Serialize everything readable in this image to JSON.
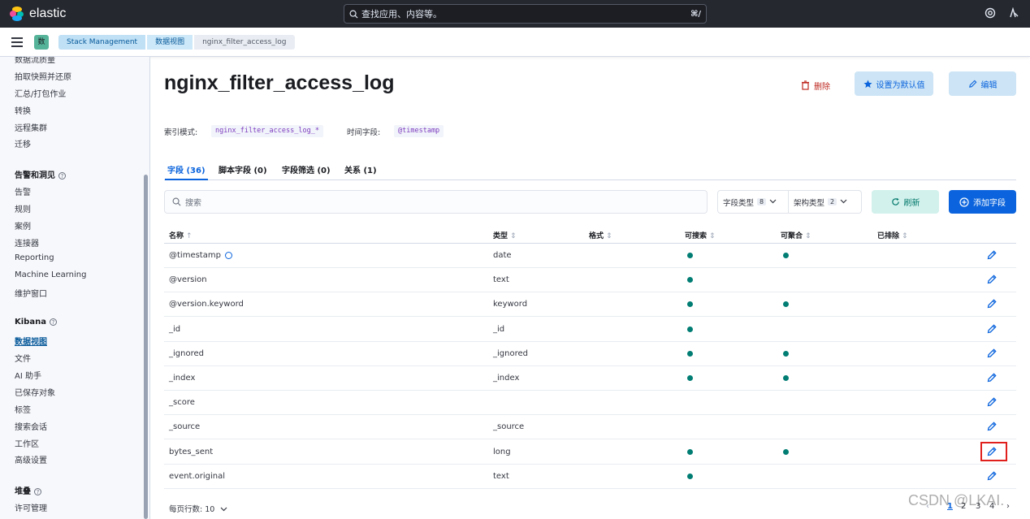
{
  "header": {
    "brand": "elastic",
    "search_placeholder": "查找应用、内容等。",
    "search_shortcut": "⌘/"
  },
  "breadcrumbs": {
    "app_badge": "数",
    "items": [
      "Stack Management",
      "数据视图",
      "nginx_filter_access_log"
    ]
  },
  "sidebar": {
    "top_items": [
      "数据流质量",
      "拍取快照并还原",
      "汇总/打包作业",
      "转换",
      "远程集群",
      "迁移"
    ],
    "sections": [
      {
        "title": "告警和洞见",
        "items": [
          "告警",
          "规则",
          "案例",
          "连接器",
          "Reporting",
          "Machine Learning",
          "维护窗口"
        ]
      },
      {
        "title": "Kibana",
        "items": [
          "数据视图",
          "文件",
          "AI 助手",
          "已保存对象",
          "标签",
          "搜索会话",
          "工作区",
          "高级设置"
        ]
      },
      {
        "title": "堆叠",
        "items": [
          "许可管理"
        ]
      }
    ]
  },
  "page": {
    "title": "nginx_filter_access_log",
    "delete_label": "删除",
    "set_default_label": "设置为默认值",
    "edit_label": "编辑",
    "index_pattern_label": "索引模式:",
    "index_pattern_value": "nginx_filter_access_log_*",
    "time_field_label": "时间字段:",
    "time_field_value": "@timestamp"
  },
  "tabs": [
    "字段 (36)",
    "脚本字段 (0)",
    "字段筛选 (0)",
    "关系 (1)"
  ],
  "toolbar": {
    "search_placeholder": "搜索",
    "field_type_label": "字段类型",
    "field_type_count": "8",
    "schema_type_label": "架构类型",
    "schema_type_count": "2",
    "refresh_label": "刷新",
    "add_field_label": "添加字段"
  },
  "table": {
    "columns": [
      "名称",
      "类型",
      "格式",
      "可搜索",
      "可聚合",
      "已排除"
    ],
    "rows": [
      {
        "name": "@timestamp",
        "type": "date",
        "searchable": true,
        "aggregatable": true
      },
      {
        "name": "@version",
        "type": "text",
        "searchable": true,
        "aggregatable": false
      },
      {
        "name": "@version.keyword",
        "type": "keyword",
        "searchable": true,
        "aggregatable": true
      },
      {
        "name": "_id",
        "type": "_id",
        "searchable": true,
        "aggregatable": false
      },
      {
        "name": "_ignored",
        "type": "_ignored",
        "searchable": true,
        "aggregatable": true
      },
      {
        "name": "_index",
        "type": "_index",
        "searchable": true,
        "aggregatable": true
      },
      {
        "name": "_score",
        "type": "",
        "searchable": false,
        "aggregatable": false
      },
      {
        "name": "_source",
        "type": "_source",
        "searchable": false,
        "aggregatable": false
      },
      {
        "name": "bytes_sent",
        "type": "long",
        "searchable": true,
        "aggregatable": true
      },
      {
        "name": "event.original",
        "type": "text",
        "searchable": true,
        "aggregatable": false
      }
    ]
  },
  "footer": {
    "rows_per_page": "每页行数: 10",
    "pages": [
      "1",
      "2",
      "3",
      "4"
    ]
  },
  "watermark": "CSDN @LKAI.",
  "colors": {
    "primary": "#0b64dd",
    "success": "#017d73",
    "danger": "#bd271e",
    "header": "#25282f"
  }
}
